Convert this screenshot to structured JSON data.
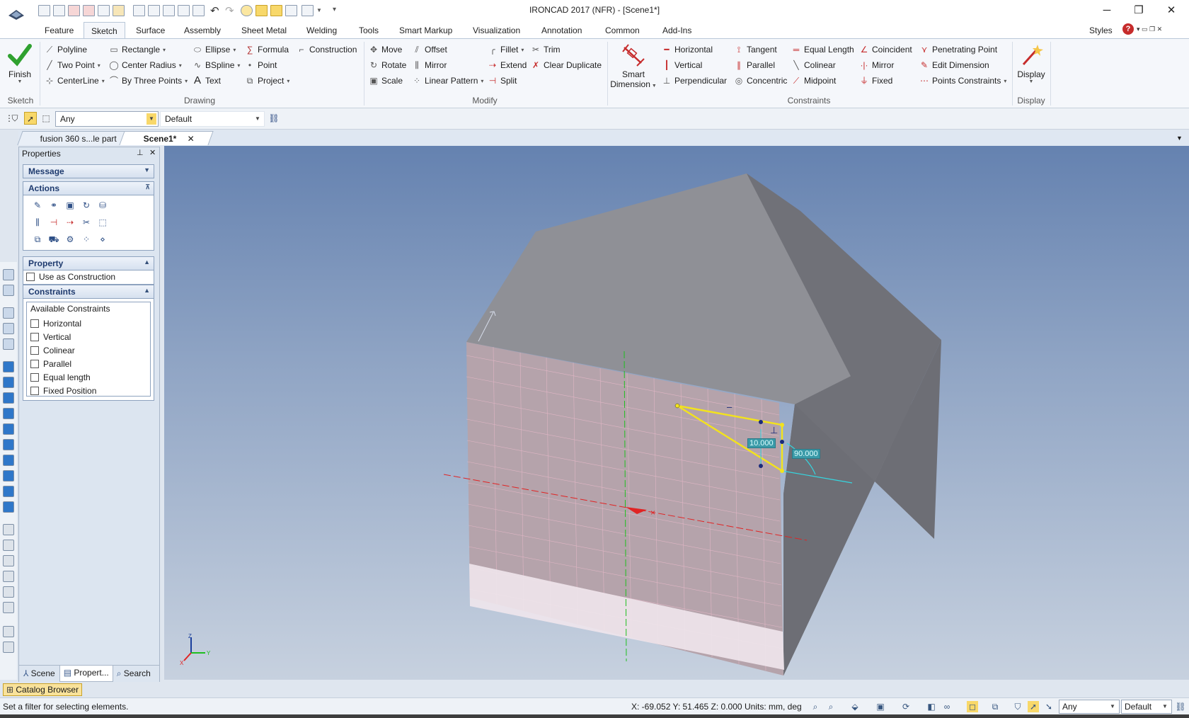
{
  "window": {
    "title": "IRONCAD 2017 (NFR) - [Scene1*]",
    "controls": [
      "minimize",
      "restore",
      "close"
    ]
  },
  "menu_tabs": [
    "Feature",
    "Sketch",
    "Surface",
    "Assembly",
    "Sheet Metal",
    "Welding",
    "Tools",
    "Smart Markup",
    "Visualization",
    "Annotation",
    "Common",
    "Add-Ins"
  ],
  "styles_label": "Styles",
  "ribbon": {
    "sketch_group": {
      "label": "Sketch",
      "finish": "Finish"
    },
    "drawing_group": {
      "label": "Drawing",
      "col1": [
        "Polyline",
        "Two Point",
        "CenterLine"
      ],
      "col2": [
        "Rectangle",
        "Center Radius",
        "By Three Points"
      ],
      "col3": [
        "Ellipse",
        "BSpline",
        "Text"
      ],
      "col4": [
        "Formula",
        "Point",
        "Project"
      ],
      "col5": [
        "Construction"
      ]
    },
    "modify_group": {
      "label": "Modify",
      "col1": [
        "Move",
        "Rotate",
        "Scale"
      ],
      "col2": [
        "Offset",
        "Mirror",
        "Linear Pattern"
      ],
      "col3": [
        "Fillet",
        "Extend",
        "Split"
      ],
      "col4": [
        "Trim",
        "Clear Duplicate"
      ]
    },
    "constraints_group": {
      "label": "Constraints",
      "smart_dimension": [
        "Smart",
        "Dimension"
      ],
      "col1": [
        "Horizontal",
        "Vertical",
        "Perpendicular"
      ],
      "col2": [
        "Tangent",
        "Parallel",
        "Concentric"
      ],
      "col3": [
        "Equal Length",
        "Colinear",
        "Midpoint"
      ],
      "col4": [
        "Coincident",
        "Mirror",
        "Fixed"
      ],
      "col5": [
        "Penetrating Point",
        "Edit Dimension",
        "Points Constraints"
      ]
    },
    "display_group": {
      "label": "Display",
      "button": "Display"
    }
  },
  "filter": {
    "selection": "Any",
    "style": "Default"
  },
  "doc_tabs": [
    {
      "label": "fusion 360 s...le part",
      "active": false
    },
    {
      "label": "Scene1*",
      "active": true
    }
  ],
  "properties_panel": {
    "title": "Properties",
    "message": "Message",
    "actions": "Actions",
    "property": "Property",
    "use_as_construction": "Use as Construction",
    "constraints": "Constraints",
    "available_constraints": "Available Constraints",
    "constraint_items": [
      "Horizontal",
      "Vertical",
      "Colinear",
      "Parallel",
      "Equal length",
      "Fixed Position"
    ],
    "bottom_tabs": [
      "Scene",
      "Propert...",
      "Search"
    ]
  },
  "viewport": {
    "dimension_1": "10.000",
    "dimension_2": "90.000",
    "triad_labels": {
      "z": "Z",
      "y": "Y",
      "x": "X"
    }
  },
  "catalog_browser": "Catalog Browser",
  "status": {
    "message": "Set a filter for selecting elements.",
    "coords": "X: -69.052 Y: 51.465 Z: 0.000",
    "units": "Units: mm, deg",
    "selection": "Any",
    "style": "Default"
  },
  "colors": {
    "accent": "#f5c64a",
    "sketch_line": "#f2e21e",
    "dimension": "#35d6e0",
    "x_axis": "#e02424",
    "y_axis": "#1fbf1f"
  }
}
